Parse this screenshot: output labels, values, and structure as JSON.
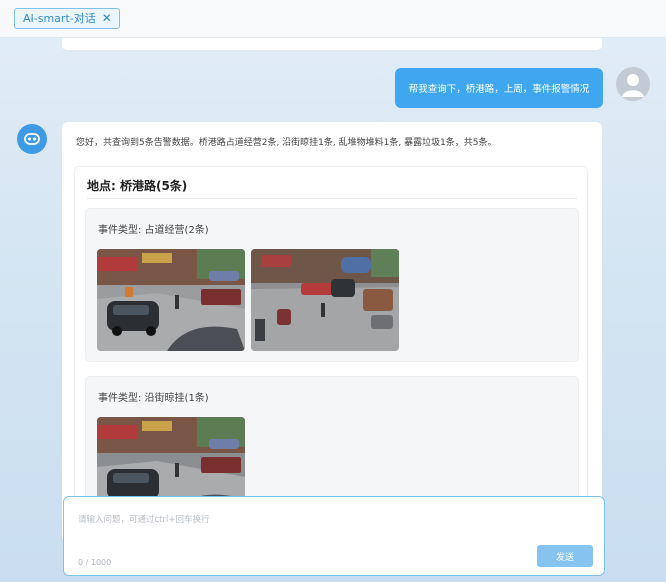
{
  "tab": {
    "label": "AI-smart-对话",
    "close": "✕"
  },
  "user_message": "帮我查询下，桥港路，上周，事件报警情况",
  "ai_response": {
    "summary": "您好，共查询到5条告警数据。桥港路占道经营2条, 沿街晾挂1条, 乱堆物堆料1条, 暴露垃圾1条，共5条。",
    "location": {
      "title": "地点: 桥港路(5条)",
      "events": [
        {
          "label": "事件类型: 占道经营(2条)",
          "photo_count": 2
        },
        {
          "label": "事件类型: 沿街晾挂(1条)",
          "photo_count": 1
        }
      ]
    }
  },
  "input": {
    "placeholder": "请输入问题，可通过ctrl+回车换行",
    "counter": "0 / 1000",
    "send_label": "发送"
  },
  "colors": {
    "accent": "#3ea7ef",
    "send_button": "#86c3ef",
    "input_border": "#7cc3ee"
  }
}
